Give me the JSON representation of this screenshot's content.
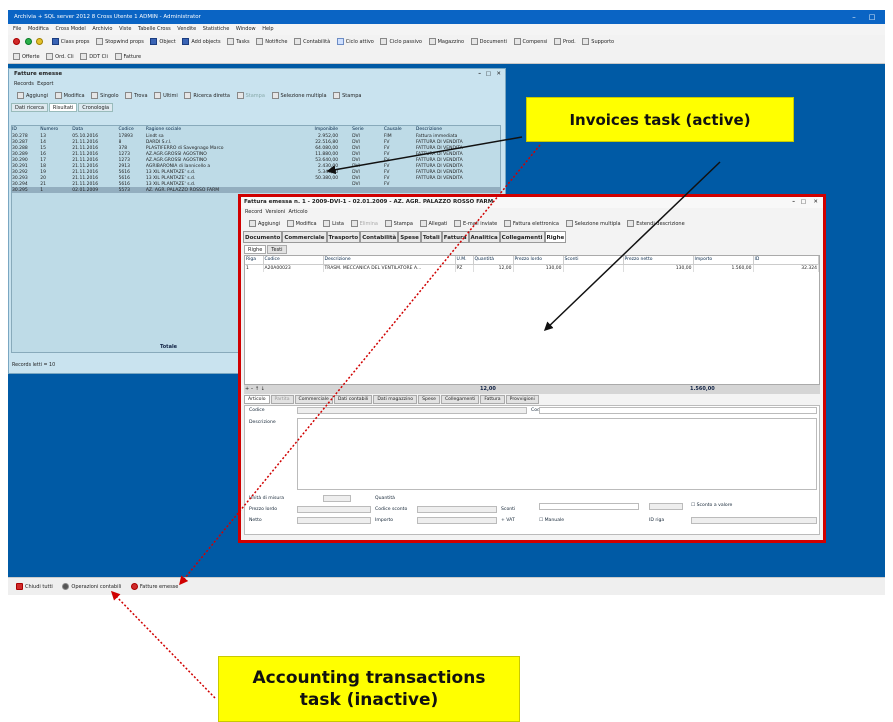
{
  "app": {
    "title": "Archivia + SQL server 2012 8 Cross Utente 1 ADMIN - Administrator",
    "min": "–",
    "max": "□"
  },
  "menu": [
    "File",
    "Modifica",
    "Cross Model",
    "Archivio",
    "Viste",
    "Tabelle Cross",
    "Vendite",
    "Statistiche",
    "Window",
    "Help"
  ],
  "toolbar1": [
    "Class props",
    "Stopwind props",
    "Object",
    "Add objects",
    "Tasks",
    "Notifiche",
    "Contabilità",
    "Ciclo attivo",
    "Ciclo passivo",
    "Magazzino",
    "Documenti",
    "Compensi",
    "Prod.",
    "Supporto"
  ],
  "toolbar2": [
    "Offerte",
    "Ord. Cli",
    "DDT Cli",
    "Fatture"
  ],
  "left_window": {
    "title": "Fatture emesse",
    "menu": [
      "Records",
      "Export"
    ],
    "tools": [
      "Aggiungi",
      "Modifica",
      "Singolo",
      "Trova",
      "Ultimi",
      "Ricerca diretta",
      "Stampa",
      "Selezione multipla",
      "Stampa"
    ],
    "tabs": [
      "Dati ricerca",
      "Risultati",
      "Cronologia"
    ],
    "columns": [
      "ID",
      "Numero",
      "Data",
      "Codice",
      "Ragione sociale",
      "Imponibile",
      "Serie",
      "Causale",
      "Descrizione"
    ],
    "rows": [
      [
        "30.278",
        "13",
        "05.10.2016",
        "17893",
        "Lindt sa",
        "2.952,00",
        "DVI",
        "FIM",
        "Fattura immediata"
      ],
      [
        "30.287",
        "14",
        "21.11.2016",
        "8",
        "DARDI S.r.l.",
        "22.516,80",
        "DVI",
        "FV",
        "FATTURA DI VENDITA"
      ],
      [
        "30.288",
        "15",
        "21.11.2016",
        "378",
        "PLASTIFERRO di Savegnago Marco",
        "64.080,00",
        "DVI",
        "FV",
        "FATTURA DI VENDITA"
      ],
      [
        "30.289",
        "16",
        "21.11.2016",
        "1273",
        "AZ.AGR.GROSSI AGOSTINO",
        "11.880,00",
        "DVI",
        "FV",
        "FATTURA DI VENDITA"
      ],
      [
        "30.290",
        "17",
        "21.11.2016",
        "1273",
        "AZ.AGR.GROSSI AGOSTINO",
        "53.640,00",
        "DVI",
        "FV",
        "FATTURA DI VENDITA"
      ],
      [
        "30.291",
        "18",
        "21.11.2016",
        "2913",
        "AGRIBARONIA di Iannicello a",
        "2.430,00",
        "DVI",
        "FV",
        "FATTURA DI VENDITA"
      ],
      [
        "30.292",
        "19",
        "21.11.2016",
        "5616",
        "13 XIL PLANTAZE' s.d.",
        "5.340,00",
        "DVI",
        "FV",
        "FATTURA DI VENDITA"
      ],
      [
        "30.293",
        "20",
        "21.11.2016",
        "5616",
        "13 XIL PLANTAZE' s.d.",
        "50.380,00",
        "DVI",
        "FV",
        "FATTURA DI VENDITA"
      ],
      [
        "30.294",
        "21",
        "21.11.2016",
        "5616",
        "13 XIL PLANTAZE' s.d.",
        "",
        "DVI",
        "FV",
        ""
      ],
      [
        "30.295",
        "1",
        "02.01.2009",
        "5573",
        "AZ. AGR. PALAZZO ROSSO FARM",
        "",
        "",
        "",
        ""
      ]
    ],
    "total_label": "Totale",
    "status": "Records letti = 10"
  },
  "right_window": {
    "title": "Fattura emessa n. 1 - 2009-DVI-1  -  02.01.2009  -  AZ. AGR. PALAZZO ROSSO FARM",
    "menu": [
      "Record",
      "Versioni",
      "Articolo"
    ],
    "tools": [
      "Aggiungi",
      "Modifica",
      "Lista",
      "Elimina",
      "Stampa",
      "Allegati",
      "E-mail inviate",
      "Fattura elettronica",
      "Selezione multipla",
      "Estendi descrizione"
    ],
    "tabs": [
      "Documento",
      "Commerciale",
      "Trasporto",
      "Contabilità",
      "Spese",
      "Totali",
      "Fattura",
      "Analitica",
      "Collegamenti",
      "Righe"
    ],
    "subtabs": [
      "Righe",
      "Testi"
    ],
    "columns": [
      "Riga",
      "Codice",
      "Descrizione",
      "U.M.",
      "Quantità",
      "Prezzo lordo",
      "Sconti",
      "Prezzo netto",
      "Importo",
      "ID"
    ],
    "rows": [
      [
        "1",
        "A20A00023",
        "TRASM. MECCANICA DEL VENTILATORE A...",
        "PZ",
        "12,00",
        "130,00",
        "",
        "130,00",
        "1.560,00",
        "32.324"
      ]
    ],
    "total_qty": "12,00",
    "total_amount": "1.560,00",
    "detail_tabs": [
      "Articolo",
      "Partita",
      "Commerciale",
      "Dati contabili",
      "Dati magazzino",
      "Spese",
      "Collegamenti",
      "Fattura",
      "Provvigioni"
    ],
    "detail_labels": {
      "codice": "Codice",
      "cod_esterno": "Cod. esterno",
      "descrizione": "Descrizione",
      "unita": "Unità di misura",
      "quantita": "Quantità",
      "prezzo_lordo": "Prezzo lordo",
      "codice_sconto": "Codice sconto",
      "sconti": "Sconti",
      "sconto_valore": "Sconto a valore",
      "netto": "Netto",
      "importo": "Importo",
      "vat": "+ VAT",
      "manuale": "Manuale",
      "id_riga": "ID riga"
    }
  },
  "taskbar": [
    "Chiudi tutti",
    "Operazioni contabili",
    "Fatture emesse"
  ],
  "callouts": {
    "active": "Invoices task (active)",
    "inactive_line1": "Accounting transactions",
    "inactive_line2": "task (inactive)"
  }
}
